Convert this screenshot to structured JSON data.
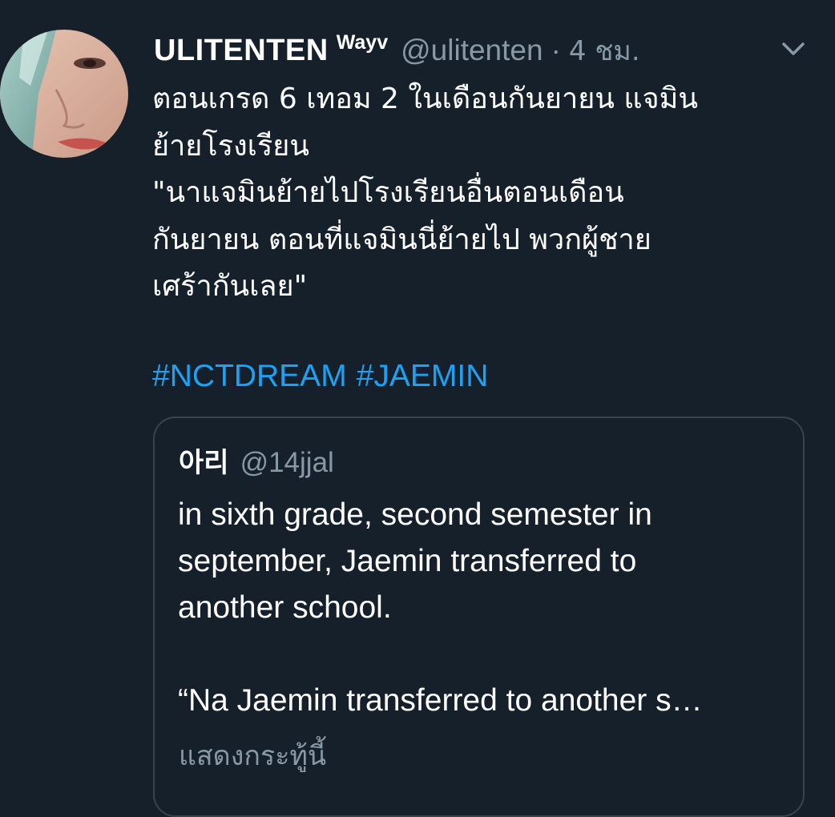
{
  "tweet": {
    "display_name": "ULITENTEN",
    "name_suffix": "Wayv",
    "handle": "@ulitenten",
    "separator": "·",
    "timestamp": "4 ชม.",
    "text_lines": [
      "ตอนเกรด 6 เทอม 2 ในเดือนกันยายน แจมิน",
      "ย้ายโรงเรียน",
      "\"นาแจมินย้ายไปโรงเรียนอื่นตอนเดือน",
      "กันยายน ตอนที่แจมินนี่ย้ายไป พวกผู้ชาย",
      "เศร้ากันเลย\""
    ],
    "hashtags": [
      "#NCTDREAM",
      "#JAEMIN"
    ],
    "menu_icon": "chevron-down-icon"
  },
  "quote": {
    "name": "아리",
    "handle": "@14jjal",
    "text_lines": [
      "in sixth grade, second semester in",
      "september, Jaemin transferred to",
      "another school."
    ],
    "text_lines_2": [
      "“Na Jaemin transferred to another s…"
    ],
    "show_thread_label": "แสดงกระทู้นี้"
  },
  "colors": {
    "background": "#15202b",
    "link": "#1da1f2",
    "secondary_text": "#8899a6",
    "border": "#38444d"
  }
}
